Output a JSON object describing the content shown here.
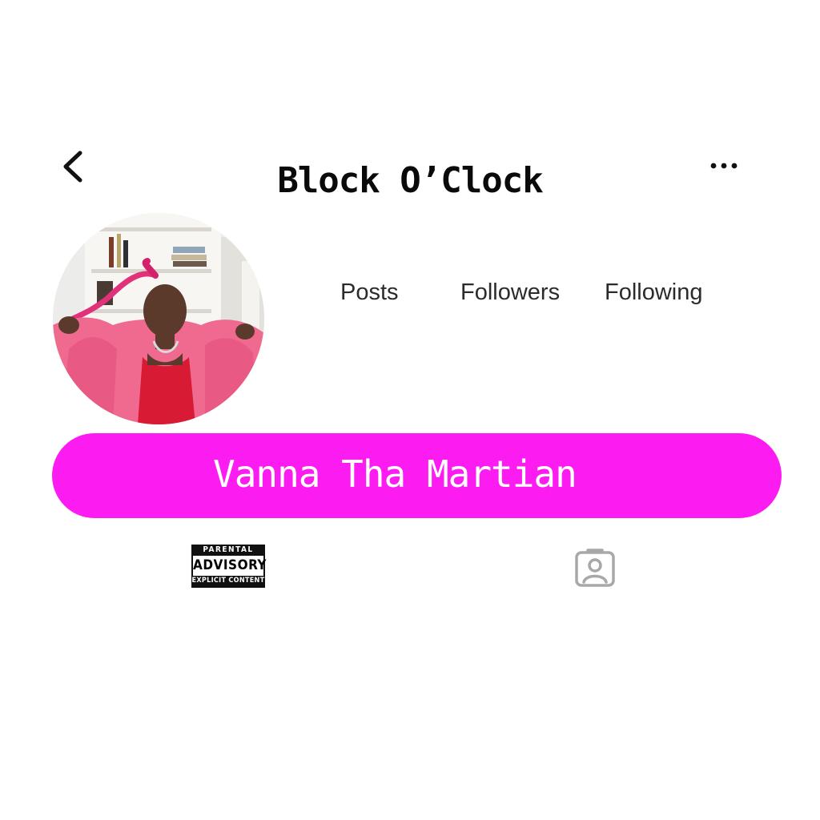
{
  "header": {
    "title": "Block O’Clock",
    "back_icon": "chevron-left-icon",
    "more_icon": "more-horizontal-icon"
  },
  "profile": {
    "avatar": "profile-photo",
    "stats": [
      {
        "label": "Posts"
      },
      {
        "label": "Followers"
      },
      {
        "label": "Following"
      }
    ],
    "name": "Vanna Tha Martian",
    "name_bar_color": "#fc1cf2"
  },
  "tabs": {
    "advisory": {
      "top": "PARENTAL",
      "middle": "ADVISORY",
      "bottom": "EXPLICIT CONTENT"
    },
    "tagged_icon": "person-tag-icon"
  }
}
